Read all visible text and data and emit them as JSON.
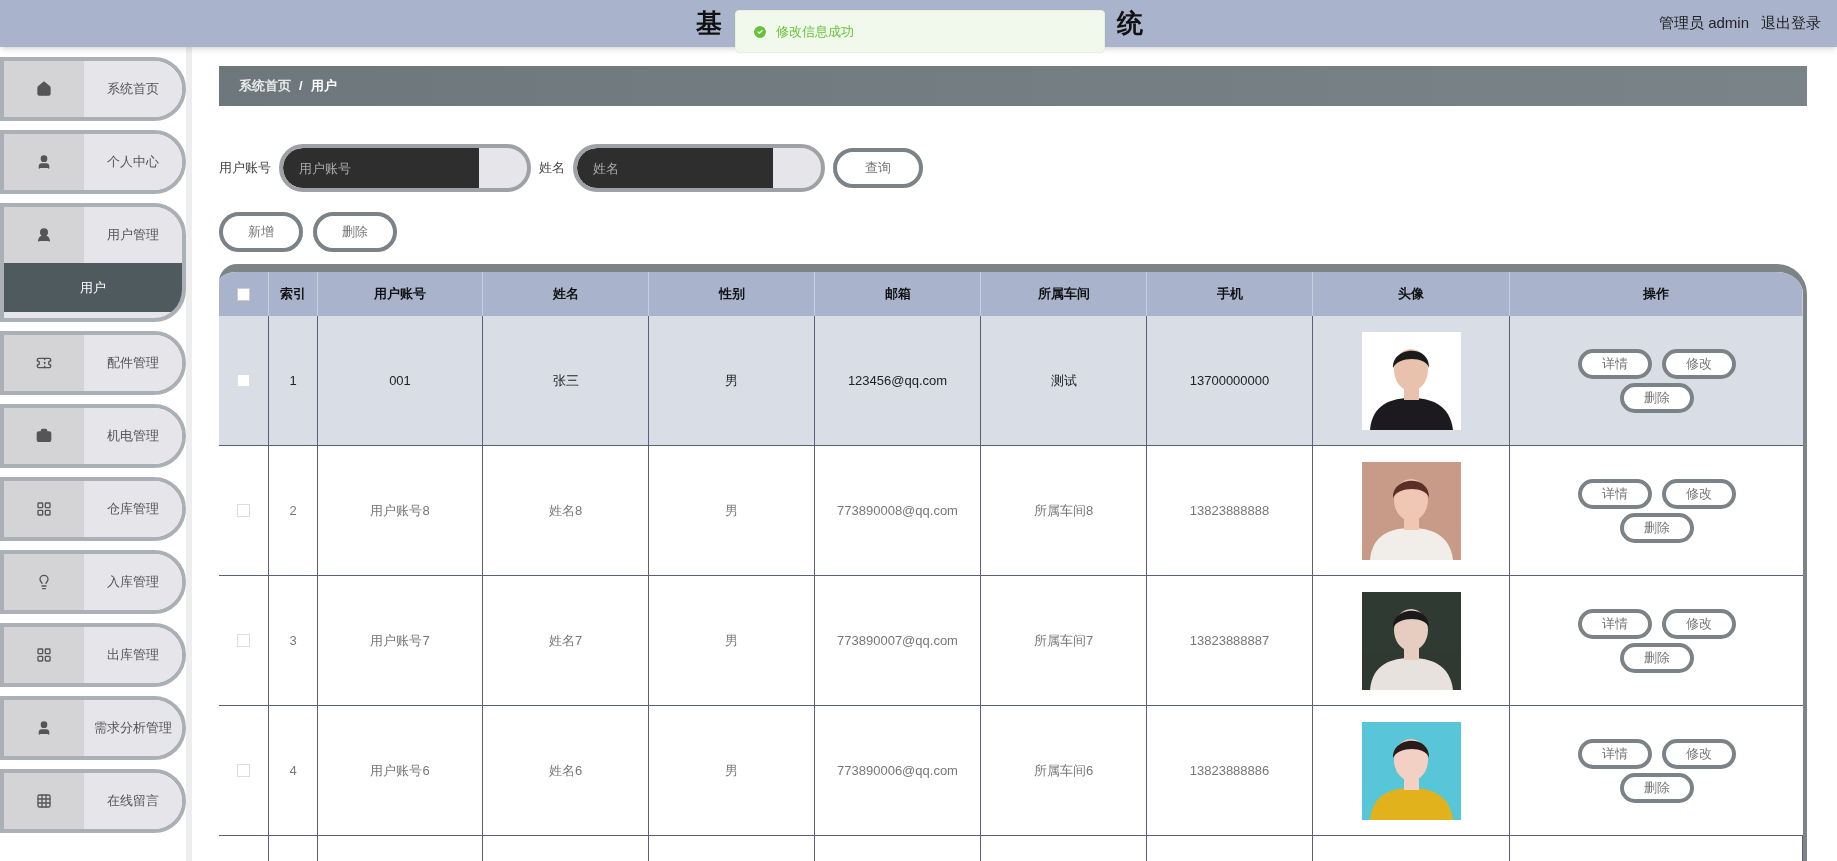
{
  "header": {
    "title_fragments": [
      "基",
      "统"
    ],
    "user": "管理员 admin",
    "logout": "退出登录"
  },
  "toast": {
    "kind": "success",
    "message": "修改信息成功"
  },
  "sidebar": {
    "items": [
      {
        "label": "系统首页",
        "expanded": false
      },
      {
        "label": "个人中心",
        "expanded": false
      },
      {
        "label": "用户管理",
        "expanded": true,
        "children": [
          {
            "label": "用户",
            "selected": true
          }
        ]
      },
      {
        "label": "配件管理",
        "expanded": false
      },
      {
        "label": "机电管理",
        "expanded": false
      },
      {
        "label": "仓库管理",
        "expanded": false
      },
      {
        "label": "入库管理",
        "expanded": false
      },
      {
        "label": "出库管理",
        "expanded": false
      },
      {
        "label": "需求分析管理",
        "expanded": false
      },
      {
        "label": "在线留言",
        "expanded": false
      }
    ]
  },
  "breadcrumb": [
    "系统首页",
    "/",
    "用户"
  ],
  "search": {
    "fields": [
      {
        "label": "用户账号",
        "placeholder": "用户账号"
      },
      {
        "label": "姓名",
        "placeholder": "姓名"
      }
    ],
    "button": "查询"
  },
  "actions": [
    "新增",
    "删除"
  ],
  "table": {
    "all_checked": false,
    "columns": [
      "索引",
      "用户账号",
      "姓名",
      "性别",
      "邮箱",
      "所属车间",
      "手机",
      "头像",
      "操作"
    ],
    "rows": [
      {
        "selected": true,
        "checked": false,
        "cells": [
          "1",
          "001",
          "张三",
          "男",
          "123456@qq.com",
          "测试",
          "13700000000"
        ],
        "buttons": [
          "详情",
          "修改",
          "删除"
        ]
      },
      {
        "selected": false,
        "checked": false,
        "cells": [
          "2",
          "用户账号8",
          "姓名8",
          "男",
          "773890008@qq.com",
          "所属车间8",
          "13823888888"
        ],
        "buttons": [
          "详情",
          "修改",
          "删除"
        ]
      },
      {
        "selected": false,
        "checked": false,
        "cells": [
          "3",
          "用户账号7",
          "姓名7",
          "男",
          "773890007@qq.com",
          "所属车间7",
          "13823888887"
        ],
        "buttons": [
          "详情",
          "修改",
          "删除"
        ]
      },
      {
        "selected": false,
        "checked": false,
        "cells": [
          "4",
          "用户账号6",
          "姓名6",
          "男",
          "773890006@qq.com",
          "所属车间6",
          "13823888886"
        ],
        "buttons": [
          "详情",
          "修改",
          "删除"
        ]
      }
    ]
  }
}
